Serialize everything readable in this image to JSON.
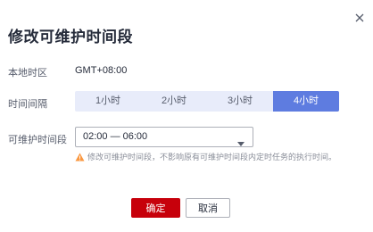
{
  "dialog": {
    "title": "修改可维护时间段",
    "close_icon": "close-icon"
  },
  "timezone": {
    "label": "本地时区",
    "value": "GMT+08:00"
  },
  "interval": {
    "label": "时间间隔",
    "options": [
      "1小时",
      "2小时",
      "3小时",
      "4小时"
    ],
    "selected": "4小时"
  },
  "window": {
    "label": "可维护时间段",
    "selected_value": "02:00 — 06:00",
    "dropdown_icon": "caret-down-icon",
    "hint_icon": "warning-icon",
    "hint": "修改可维护时间段，不影响原有可维护时间段内定时任务的执行时间。"
  },
  "buttons": {
    "confirm": "确定",
    "cancel": "取消"
  },
  "colors": {
    "primary_button": "#c7000b",
    "segment_active": "#5e7ce0",
    "segment_bg": "#e8ecfa",
    "warning": "#fa9841"
  }
}
